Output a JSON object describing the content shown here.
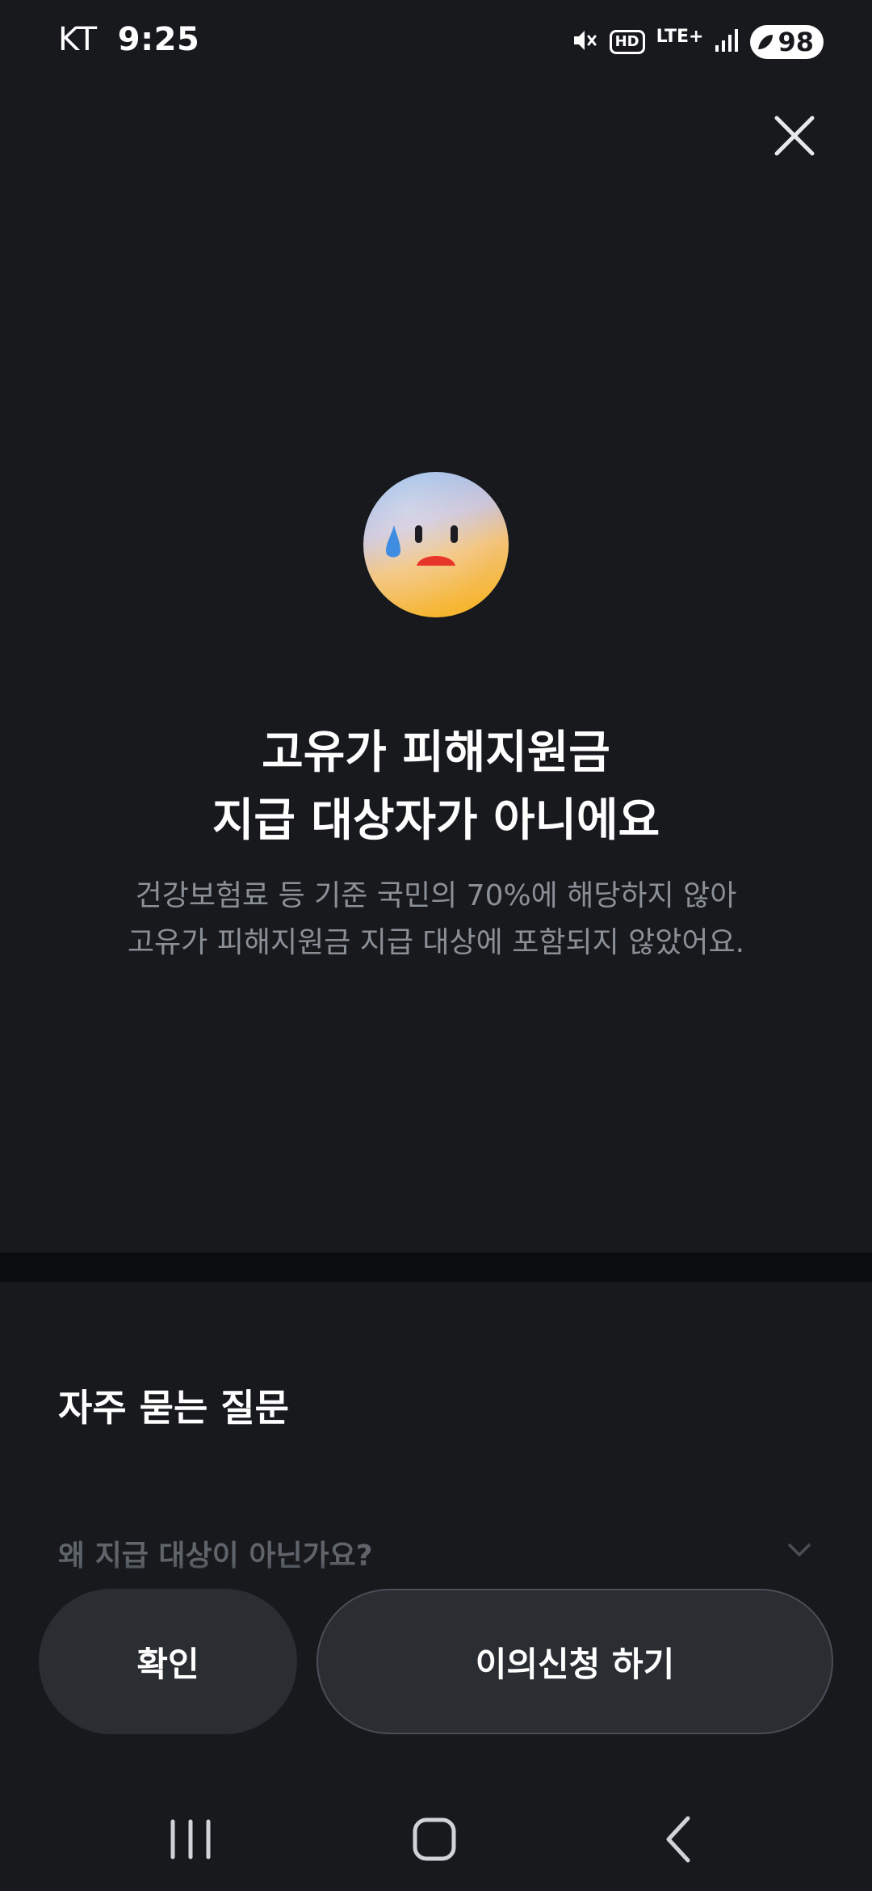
{
  "status_bar": {
    "carrier": "KT",
    "time": "9:25",
    "hd_label": "HD",
    "network_label": "LTE+",
    "battery_level": "98",
    "icons": [
      "mute-icon",
      "hd-voice-icon",
      "lte-icon",
      "signal-icon",
      "battery-icon"
    ]
  },
  "header": {
    "close_icon": "close-icon"
  },
  "result": {
    "emoji": "sad-sweat-face",
    "title_line1": "고유가 피해지원금",
    "title_line2": "지급 대상자가 아니에요",
    "desc_line1": "건강보험료 등 기준 국민의 70%에 해당하지 않아",
    "desc_line2": "고유가 피해지원금 지급 대상에 포함되지 않았어요."
  },
  "faq": {
    "title": "자주 묻는 질문",
    "items": [
      {
        "question": "왜 지급 대상이 아닌가요?",
        "icon": "chevron-down-icon"
      }
    ]
  },
  "actions": {
    "confirm_label": "확인",
    "appeal_label": "이의신청 하기"
  },
  "nav_bar": {
    "icons": [
      "recent-apps-icon",
      "home-icon",
      "back-icon"
    ]
  },
  "colors": {
    "background": "#17191d",
    "divider": "#0b0c0e",
    "button_bg": "#2a2d32",
    "secondary_text": "#8b9097",
    "faq_question_text": "#5f646b"
  }
}
